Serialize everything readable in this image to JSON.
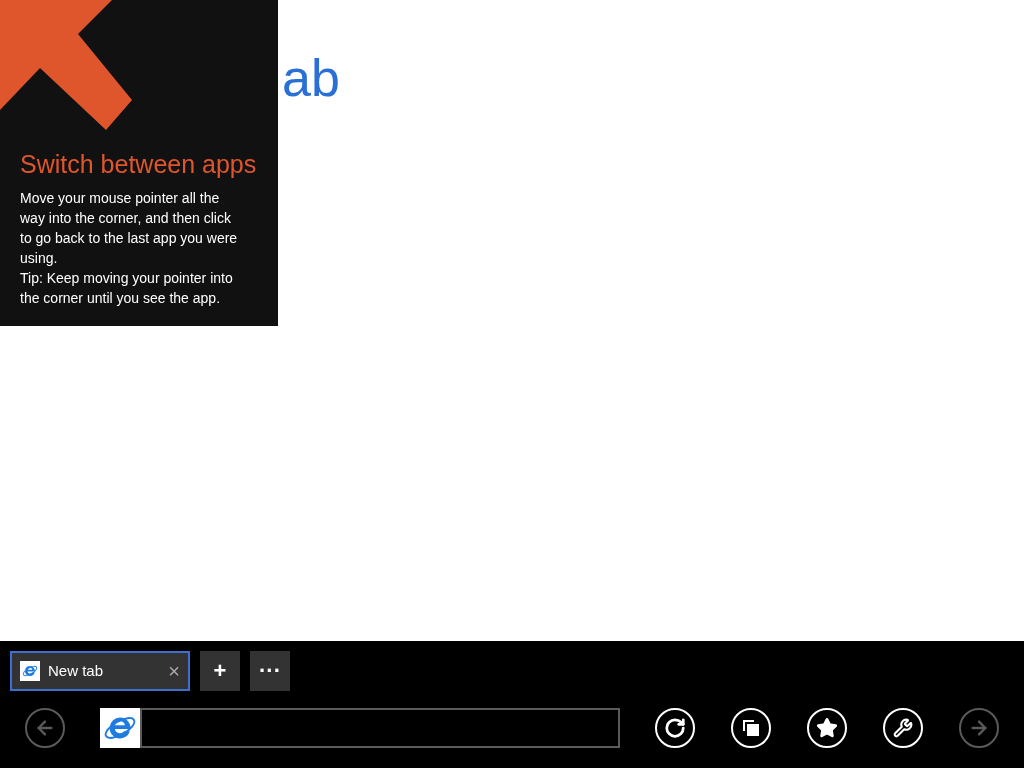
{
  "page": {
    "heading": "ab"
  },
  "tip": {
    "title": "Switch between apps",
    "paragraphs": [
      "Move your mouse pointer all the way into the corner, and then click to go back to the last app you were using.",
      "Tip: Keep moving your pointer into the corner until you see the app."
    ]
  },
  "tabs": [
    {
      "label": "New tab",
      "close": "×",
      "selected": true
    }
  ],
  "tab_actions": [
    "+",
    "···"
  ],
  "nav_buttons": [
    {
      "kind": "back",
      "disabled": true
    },
    {
      "kind": "refresh",
      "disabled": false
    },
    {
      "kind": "tabs",
      "disabled": false
    },
    {
      "kind": "favorites",
      "disabled": false
    },
    {
      "kind": "tools",
      "disabled": false
    },
    {
      "kind": "forward",
      "disabled": true
    }
  ]
}
